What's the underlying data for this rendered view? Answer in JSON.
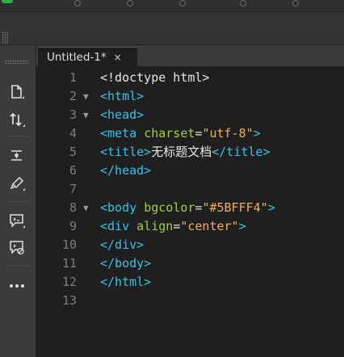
{
  "tab": {
    "title": "Untitled-1*",
    "close_glyph": "×"
  },
  "sidebar": {
    "icons": [
      "file-icon",
      "sort-icon",
      "expand-collapse-icon",
      "format-brush-icon",
      "comment-icon",
      "remove-comment-icon",
      "more-icon"
    ]
  },
  "editor": {
    "lines": [
      {
        "n": "1",
        "fold": "",
        "tokens": [
          {
            "c": "p",
            "s": "<!doctype html>"
          }
        ]
      },
      {
        "n": "2",
        "fold": "▼",
        "tokens": [
          {
            "c": "t",
            "s": "<html>"
          }
        ]
      },
      {
        "n": "3",
        "fold": "▼",
        "tokens": [
          {
            "c": "t",
            "s": "<head>"
          }
        ]
      },
      {
        "n": "4",
        "fold": "",
        "tokens": [
          {
            "c": "t",
            "s": "<meta "
          },
          {
            "c": "a",
            "s": "charset"
          },
          {
            "c": "p",
            "s": "="
          },
          {
            "c": "v",
            "s": "\"utf-8\""
          },
          {
            "c": "t",
            "s": ">"
          }
        ]
      },
      {
        "n": "5",
        "fold": "",
        "tokens": [
          {
            "c": "t",
            "s": "<title>"
          },
          {
            "c": "p cjk",
            "s": "无标题文档"
          },
          {
            "c": "t",
            "s": "</title>"
          }
        ]
      },
      {
        "n": "6",
        "fold": "",
        "tokens": [
          {
            "c": "t",
            "s": "</head>"
          }
        ]
      },
      {
        "n": "7",
        "fold": "",
        "tokens": []
      },
      {
        "n": "8",
        "fold": "▼",
        "tokens": [
          {
            "c": "t",
            "s": "<body "
          },
          {
            "c": "a",
            "s": "bgcolor"
          },
          {
            "c": "p",
            "s": "="
          },
          {
            "c": "v",
            "s": "\"#5BFFF4\""
          },
          {
            "c": "t",
            "s": ">"
          }
        ]
      },
      {
        "n": "9",
        "fold": "",
        "tokens": [
          {
            "c": "t",
            "s": "<div "
          },
          {
            "c": "a",
            "s": "align"
          },
          {
            "c": "p",
            "s": "="
          },
          {
            "c": "v",
            "s": "\"center\""
          },
          {
            "c": "t",
            "s": ">"
          }
        ]
      },
      {
        "n": "10",
        "fold": "",
        "tokens": [
          {
            "c": "t",
            "s": "</div>"
          }
        ]
      },
      {
        "n": "11",
        "fold": "",
        "tokens": [
          {
            "c": "t",
            "s": "</body>"
          }
        ]
      },
      {
        "n": "12",
        "fold": "",
        "tokens": [
          {
            "c": "t",
            "s": "</html>"
          }
        ]
      },
      {
        "n": "13",
        "fold": "",
        "tokens": []
      }
    ]
  },
  "colors": {
    "tag": "#36c3e8",
    "attribute": "#a0cf3f",
    "value": "#f2ad5a",
    "text": "#e6e6e6",
    "line_number": "#7d7d7d",
    "editor_bg": "#1f1f1f"
  }
}
